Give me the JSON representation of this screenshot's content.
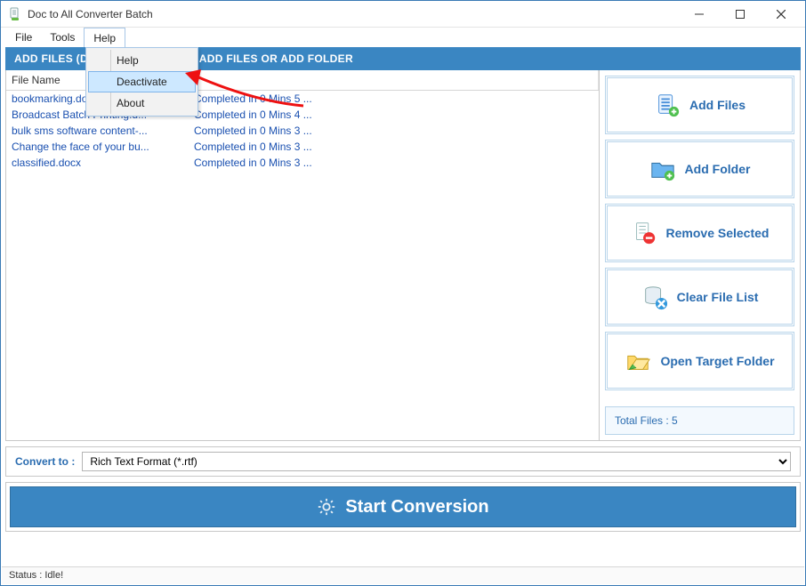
{
  "window": {
    "title": "Doc to All Converter Batch"
  },
  "menubar": {
    "items": [
      "File",
      "Tools",
      "Help"
    ],
    "open_index": 2
  },
  "help_menu": {
    "items": [
      "Help",
      "Deactivate",
      "About"
    ],
    "highlight_index": 1
  },
  "section_header": "ADD FILES (DOC, DOCX, DOT, DOTX, DOCM, DOTM, RTF) - CLICK ON ADD FILES OR ADD FOLDER",
  "section_header_visible": "ADD FILES (D                            M, RTF) - CLICK ON ADD FILES OR ADD FOLDER",
  "grid": {
    "columns": [
      "File Name",
      ""
    ],
    "rows": [
      {
        "name": "bookmarking.docx",
        "status": "Completed in 0 Mins 5 ..."
      },
      {
        "name": "Broadcast Batch Printing.d...",
        "status": "Completed in 0 Mins 4 ..."
      },
      {
        "name": "bulk sms software content-...",
        "status": "Completed in 0 Mins 3 ..."
      },
      {
        "name": "Change the face of your bu...",
        "status": "Completed in 0 Mins 3 ..."
      },
      {
        "name": "classified.docx",
        "status": "Completed in 0 Mins 3 ..."
      }
    ]
  },
  "side_buttons": {
    "add_files": "Add Files",
    "add_folder": "Add Folder",
    "remove_selected": "Remove Selected",
    "clear_list": "Clear File List",
    "open_target": "Open Target Folder"
  },
  "total_files": {
    "label": "Total Files : ",
    "value": "5"
  },
  "convert_to": {
    "label": "Convert to :",
    "selected": "Rich Text Format (*.rtf)"
  },
  "start_button": "Start Conversion",
  "statusbar": "Status  :  Idle!"
}
